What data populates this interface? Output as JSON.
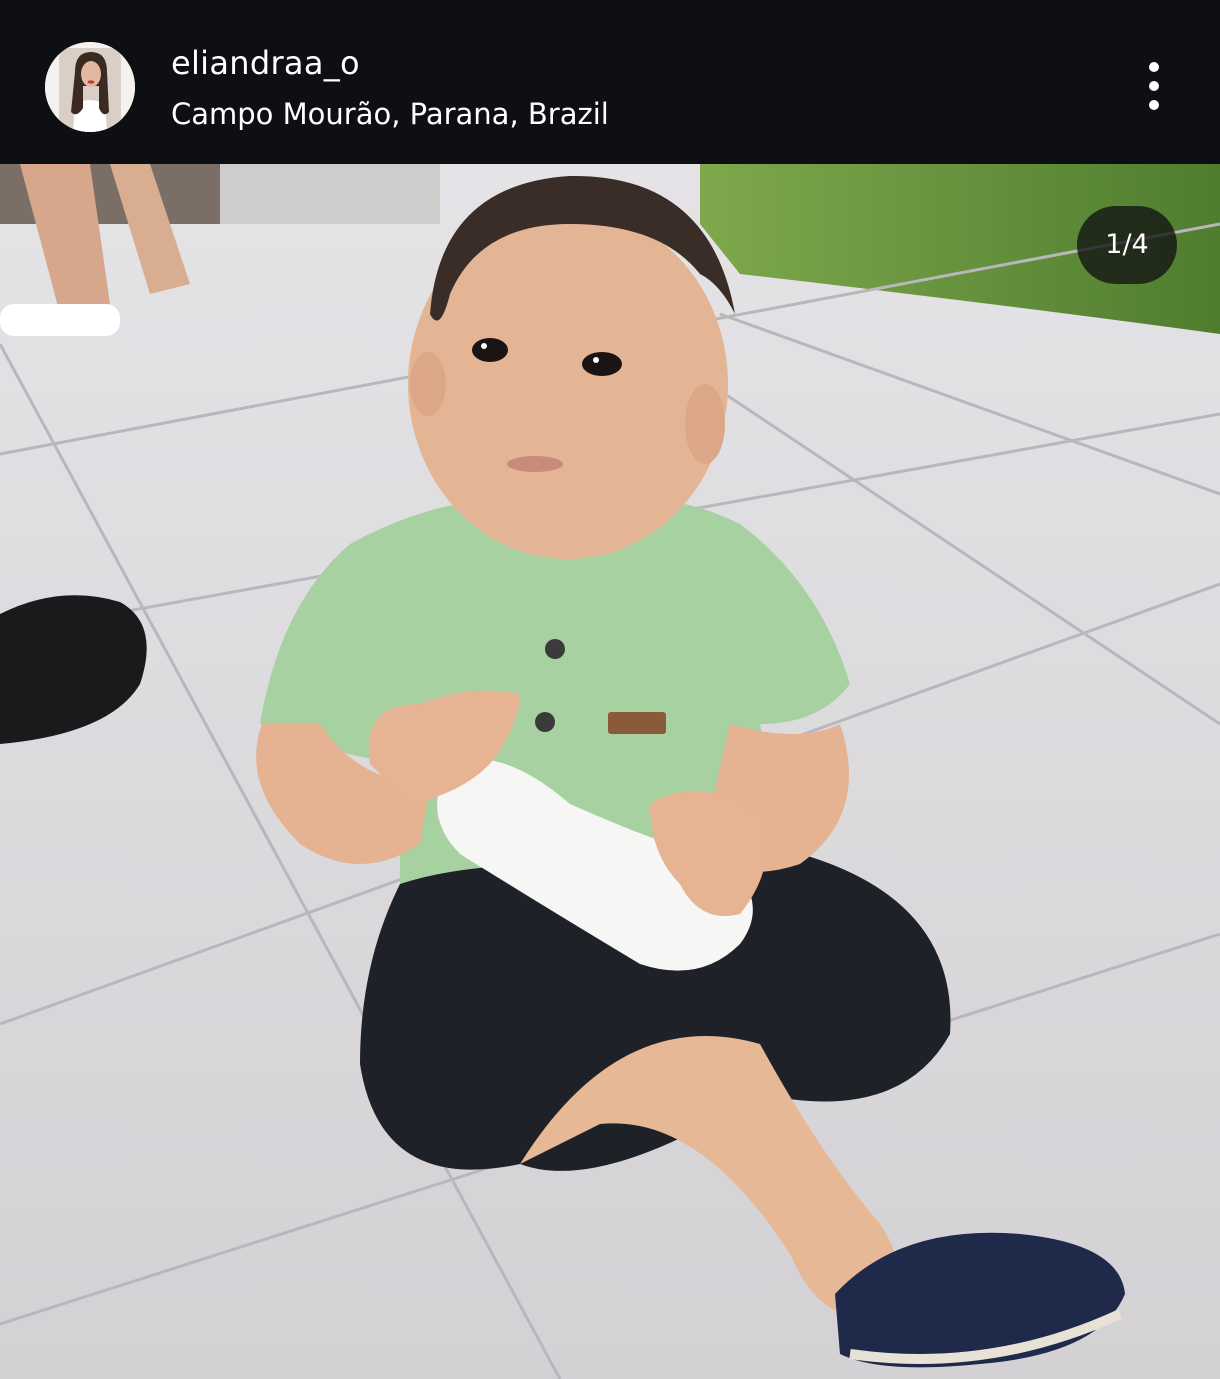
{
  "post": {
    "username": "eliandraa_o",
    "location": "Campo Mourão, Parana, Brazil",
    "carousel_counter": "1/4"
  },
  "icons": {
    "avatar": "profile-avatar",
    "more": "more-options-icon"
  },
  "colors": {
    "header_background": "#0e0f13",
    "header_text": "#ffffff",
    "counter_badge_background": "#121212"
  }
}
